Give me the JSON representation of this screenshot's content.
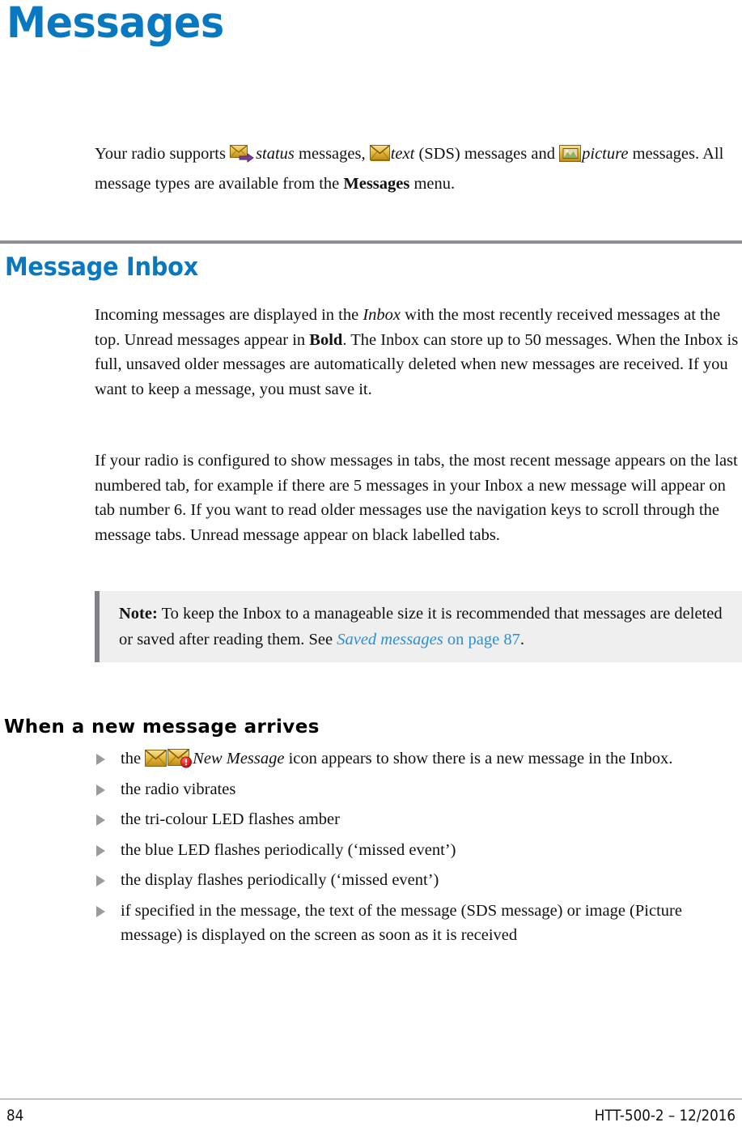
{
  "document": {
    "chapter_title": "Messages",
    "intro": {
      "before_status_icon": "Your radio supports ",
      "status_word": "status",
      "after_status_word": " messages, ",
      "text_word": "text",
      "after_text_word": " (SDS) messages and ",
      "picture_word": "picture",
      "after_picture_word": " messages. All message types are available from the ",
      "menu_name": "Messages",
      "tail": " menu."
    },
    "section": {
      "heading": "Message Inbox",
      "paragraph_incoming": {
        "part1": "Incoming messages are displayed in the ",
        "italic1": "Inbox",
        "part2": " with the most recently received messages at the top. Unread messages appear in ",
        "bold1": "Bold",
        "part3": ". The Inbox can store up to 50 messages. When the Inbox is full, unsaved older messages are automatically deleted when new messages are received. If you want to keep a message, you must save it."
      },
      "paragraph_tabs": "If your radio is configured to show messages in tabs, the most recent message appears on the last numbered tab, for example if there are 5 messages in your Inbox a new message will appear on tab number 6. If you want to read older messages use the navigation keys to scroll through the message tabs. Unread message appear on black labelled tabs."
    },
    "note": {
      "label": "Note:",
      "text_part1": " To keep the Inbox to a manageable size it is recommended that messages are deleted or saved after reading them. See ",
      "xref_italic": "Saved messages",
      "xref_rest": " on page 87",
      "tail": "."
    },
    "subsection": {
      "heading": "When a new message arrives",
      "bullets": [
        {
          "lead": "the ",
          "icon_label": "New Message",
          "rest": " icon appears to show there is a new message in the Inbox.",
          "has_icons": true
        },
        {
          "lead": "the radio vibrates",
          "has_icons": false
        },
        {
          "lead": "the tri-colour LED flashes amber",
          "has_icons": false
        },
        {
          "lead": "the blue LED flashes periodically (‘missed event’)",
          "has_icons": false
        },
        {
          "lead": "the display flashes periodically (‘missed event’)",
          "has_icons": false
        },
        {
          "lead": "if specified in the message, the text of the message (SDS message) or image (Picture message) is displayed on the screen as soon as it is received",
          "has_icons": false
        }
      ]
    },
    "icons": {
      "status_message": "status-message-envelope-arrow-icon",
      "text_message": "text-message-envelope-icon",
      "picture_message": "picture-message-envelope-icon",
      "new_message": "new-message-envelope-icon",
      "new_message_alert": "new-message-envelope-alert-icon",
      "bullet": "triangle-bullet-icon"
    },
    "colors": {
      "heading_blue": "#0878c0",
      "xref_blue": "#2b8fd0",
      "rule_gray": "#8c8f93",
      "note_background": "#efefef",
      "note_bar": "#808287",
      "bullet_gray": "#9a9a9a",
      "envelope_gold": "#e8b838",
      "arrow_purple": "#7a3f9d",
      "badge_red": "#d81f1f"
    },
    "footer": {
      "page_number": "84",
      "document_id": "HTT-500-2 – 12/2016"
    }
  }
}
